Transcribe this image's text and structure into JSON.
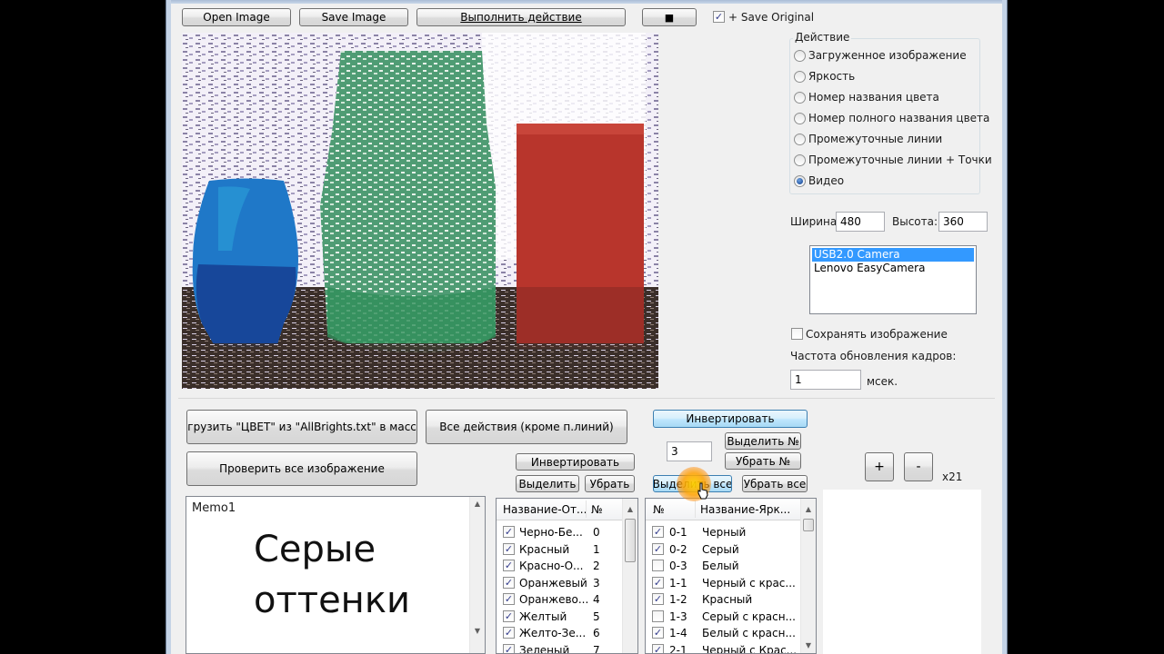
{
  "toolbar": {
    "open_label": "Open Image",
    "save_label": "Save Image",
    "perform_label": "Выполнить действие",
    "stop_label": "■",
    "save_original_label": "+ Save Original",
    "save_original_checked": true
  },
  "action_group": {
    "title": "Действие",
    "options": [
      {
        "label": "Загруженное изображение",
        "selected": false
      },
      {
        "label": "Яркость",
        "selected": false
      },
      {
        "label": "Номер названия цвета",
        "selected": false
      },
      {
        "label": "Номер полного названия цвета",
        "selected": false
      },
      {
        "label": "Промежуточные линии",
        "selected": false
      },
      {
        "label": "Промежуточные линии + Точки",
        "selected": false
      },
      {
        "label": "Видео",
        "selected": true
      }
    ]
  },
  "size": {
    "width_label": "Ширина:",
    "width_value": "480",
    "height_label": "Высота:",
    "height_value": "360"
  },
  "cameras": {
    "items": [
      "USB2.0 Camera",
      "Lenovo EasyCamera"
    ],
    "selected_index": 0
  },
  "save_image": {
    "label": "Сохранять изображение",
    "checked": false
  },
  "frame_rate": {
    "label": "Частота обновления кадров:",
    "value": "1",
    "unit": "мсек."
  },
  "controls": {
    "load_color_label": "Загрузить \"ЦВЕТ\" из \"AllBrights.txt\" в массив",
    "all_actions_label": "Все действия (кроме п.линий)",
    "invert_top_label": "Инвертировать",
    "check_all_image_label": "Проверить все изображение",
    "invert_left_label": "Инвертировать",
    "select_left_label": "Выделить",
    "remove_left_label": "Убрать",
    "number_value": "3",
    "select_num_label": "Выделить №",
    "remove_num_label": "Убрать №",
    "select_all_label": "Выделить все",
    "remove_all_label": "Убрать все",
    "plus_label": "+",
    "minus_label": "-",
    "zoom_label": "x21"
  },
  "memo": {
    "title": "Memo1",
    "text": "Серые оттенки"
  },
  "table_left": {
    "headers": [
      "Название-От...",
      "№"
    ],
    "rows": [
      {
        "name": "Черно-Бе...",
        "num": "0",
        "checked": true
      },
      {
        "name": "Красный",
        "num": "1",
        "checked": true
      },
      {
        "name": "Красно-О...",
        "num": "2",
        "checked": true
      },
      {
        "name": "Оранжевый",
        "num": "3",
        "checked": true
      },
      {
        "name": "Оранжево...",
        "num": "4",
        "checked": true
      },
      {
        "name": "Желтый",
        "num": "5",
        "checked": true
      },
      {
        "name": "Желто-Зе...",
        "num": "6",
        "checked": true
      },
      {
        "name": "Зеленый",
        "num": "7",
        "checked": true
      }
    ]
  },
  "table_right": {
    "headers": [
      "№",
      "Название-Ярк..."
    ],
    "rows": [
      {
        "num": "0-1",
        "name": "Черный",
        "checked": true
      },
      {
        "num": "0-2",
        "name": "Серый",
        "checked": true
      },
      {
        "num": "0-3",
        "name": "Белый",
        "checked": false
      },
      {
        "num": "1-1",
        "name": "Черный с крас...",
        "checked": true
      },
      {
        "num": "1-2",
        "name": "Красный",
        "checked": true
      },
      {
        "num": "1-3",
        "name": "Серый с красн...",
        "checked": false
      },
      {
        "num": "1-4",
        "name": "Белый с красн...",
        "checked": true
      },
      {
        "num": "2-1",
        "name": "Черный с Крас...",
        "checked": true
      }
    ]
  }
}
